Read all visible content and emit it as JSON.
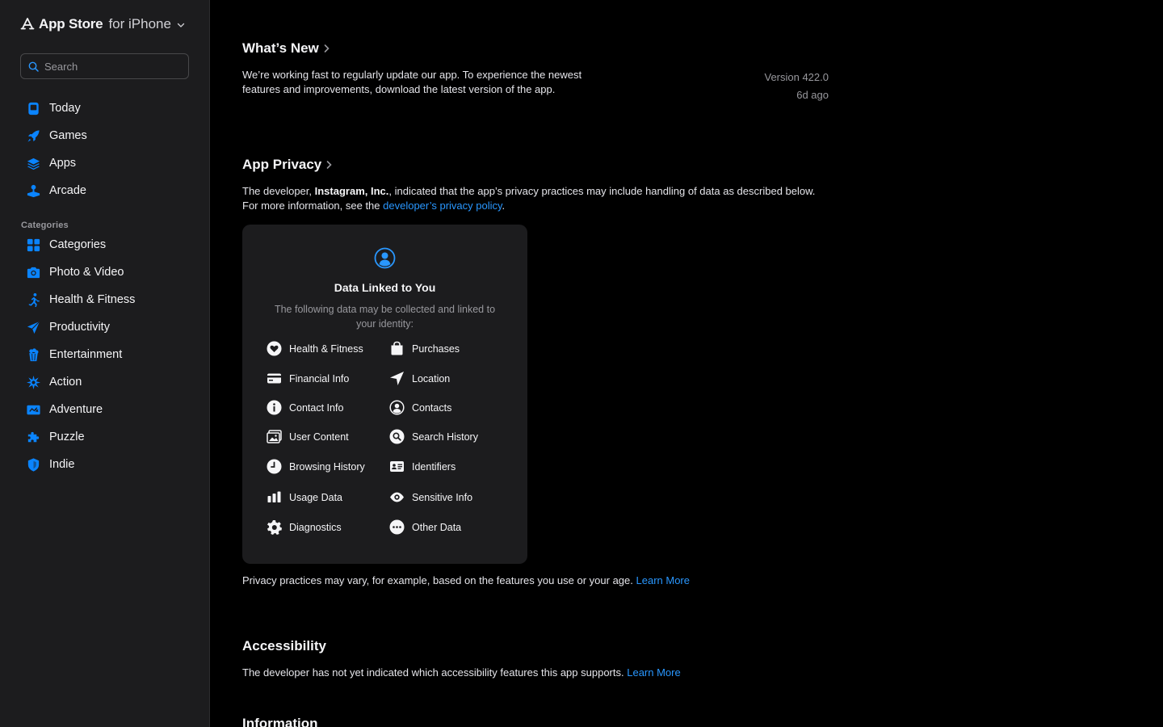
{
  "sidebar": {
    "brand": {
      "name": "App Store",
      "platform": "for iPhone"
    },
    "search": {
      "placeholder": "Search"
    },
    "nav": [
      {
        "label": "Today",
        "icon": "today-icon"
      },
      {
        "label": "Games",
        "icon": "rocket-icon"
      },
      {
        "label": "Apps",
        "icon": "layers-icon"
      },
      {
        "label": "Arcade",
        "icon": "joystick-icon"
      }
    ],
    "categories_heading": "Categories",
    "categories": [
      {
        "label": "Categories",
        "icon": "grid-icon"
      },
      {
        "label": "Photo & Video",
        "icon": "camera-icon"
      },
      {
        "label": "Health & Fitness",
        "icon": "running-icon"
      },
      {
        "label": "Productivity",
        "icon": "paperplane-icon"
      },
      {
        "label": "Entertainment",
        "icon": "popcorn-icon"
      },
      {
        "label": "Action",
        "icon": "burst-icon"
      },
      {
        "label": "Adventure",
        "icon": "map-icon"
      },
      {
        "label": "Puzzle",
        "icon": "puzzle-icon"
      },
      {
        "label": "Indie",
        "icon": "shield-icon"
      }
    ]
  },
  "whats_new": {
    "title": "What’s New",
    "text": "We’re working fast to regularly update our app. To experience the newest features and improvements, download the latest version of the app.",
    "version": "Version 422.0",
    "ago": "6d ago"
  },
  "app_privacy": {
    "title": "App Privacy",
    "intro_prefix": "The developer, ",
    "developer": "Instagram, Inc.",
    "intro_middle": ", indicated that the app’s privacy practices may include handling of data as described below. For more information, see the ",
    "policy_link": "developer’s privacy policy",
    "intro_suffix": ".",
    "card": {
      "title": "Data Linked to You",
      "description": "The following data may be collected and linked to your identity:",
      "items_left": [
        "Health & Fitness",
        "Financial Info",
        "Contact Info",
        "User Content",
        "Browsing History",
        "Usage Data",
        "Diagnostics"
      ],
      "items_right": [
        "Purchases",
        "Location",
        "Contacts",
        "Search History",
        "Identifiers",
        "Sensitive Info",
        "Other Data"
      ]
    },
    "footer_text": "Privacy practices may vary, for example, based on the features you use or your age.",
    "footer_link": "Learn More"
  },
  "accessibility": {
    "title": "Accessibility",
    "text": "The developer has not yet indicated which accessibility features this app supports.",
    "link": "Learn More"
  },
  "information": {
    "title": "Information"
  },
  "colors": {
    "accent": "#2997ff",
    "sidebar_bg": "#1c1c1e",
    "page_bg": "#000000"
  }
}
